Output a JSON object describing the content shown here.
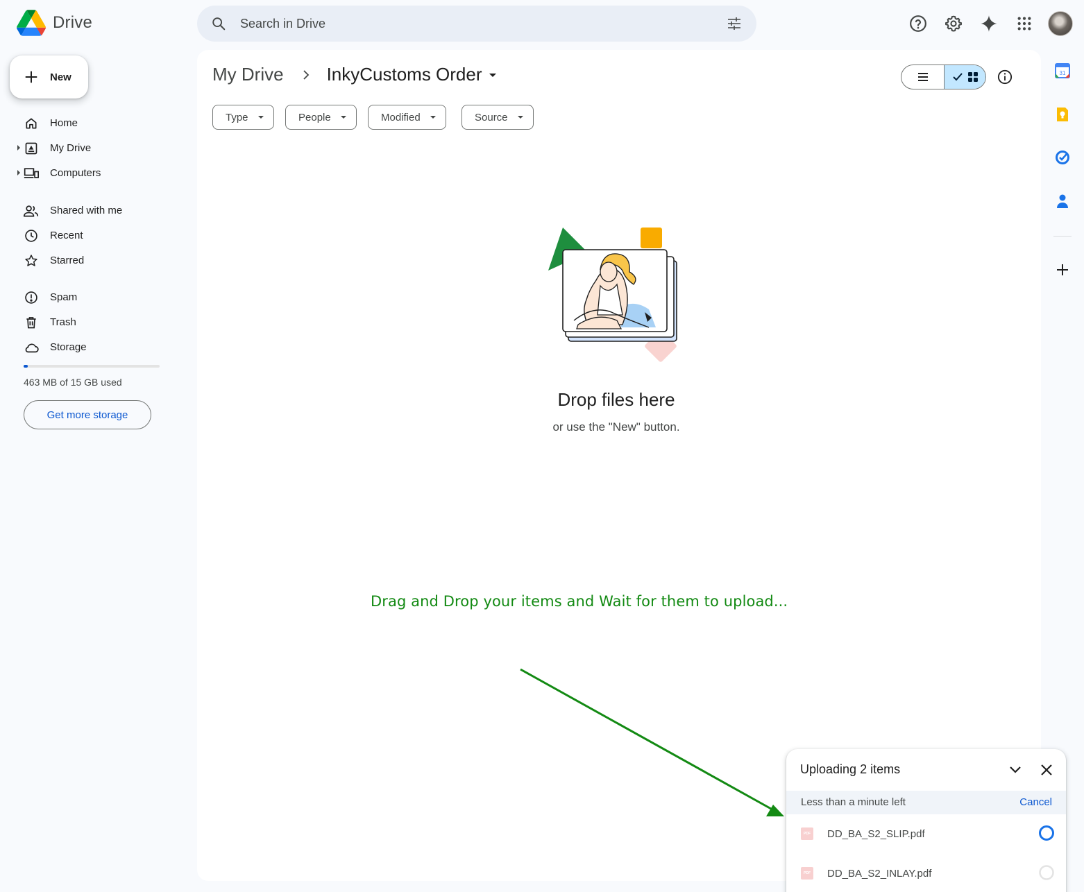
{
  "app": {
    "title": "Drive",
    "brand_colors": {
      "blue": "#4285f4",
      "green": "#0f9d58",
      "yellow": "#f4b400",
      "red": "#db4437"
    }
  },
  "search": {
    "placeholder": "Search in Drive"
  },
  "sidebar": {
    "new_label": "New",
    "items": [
      {
        "label": "Home",
        "icon": "home-icon"
      },
      {
        "label": "My Drive",
        "icon": "my-drive-icon"
      },
      {
        "label": "Computers",
        "icon": "computers-icon"
      },
      {
        "label": "Shared with me",
        "icon": "shared-icon"
      },
      {
        "label": "Recent",
        "icon": "clock-icon"
      },
      {
        "label": "Starred",
        "icon": "star-icon"
      },
      {
        "label": "Spam",
        "icon": "spam-icon"
      },
      {
        "label": "Trash",
        "icon": "trash-icon"
      },
      {
        "label": "Storage",
        "icon": "cloud-icon"
      }
    ],
    "storage": {
      "used_text": "463 MB of 15 GB used",
      "used_fraction": 0.03,
      "button_label": "Get more storage"
    }
  },
  "main": {
    "breadcrumb": {
      "root": "My Drive",
      "current": "InkyCustoms Order"
    },
    "filters": [
      "Type",
      "People",
      "Modified",
      "Source"
    ],
    "view": "grid",
    "empty_state": {
      "title": "Drop files here",
      "subtitle": "or use the \"New\" button."
    },
    "annotation": "Drag and Drop your items and Wait for them to upload..."
  },
  "right_rail": [
    "calendar-icon",
    "keep-icon",
    "tasks-icon",
    "contacts-icon",
    "add-icon"
  ],
  "upload_panel": {
    "title": "Uploading 2 items",
    "status": "Less than a minute left",
    "cancel_label": "Cancel",
    "files": [
      {
        "name": "DD_BA_S2_SLIP.pdf",
        "state": "uploading"
      },
      {
        "name": "DD_BA_S2_INLAY.pdf",
        "state": "queued"
      }
    ]
  }
}
